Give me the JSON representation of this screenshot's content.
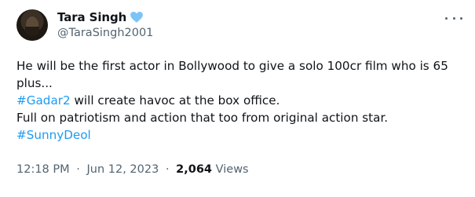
{
  "author": {
    "display_name": "Tara Singh",
    "handle": "@TaraSingh2001",
    "verified_color": "#7cc4f8"
  },
  "tweet": {
    "line1": "He will be the first actor in Bollywood to give a solo 100cr film who is 65",
    "line2": "plus...",
    "hashtag1": "#Gadar2",
    "line3_rest": " will create havoc at the box office.",
    "line4": "Full on patriotism and action that too from original action star.",
    "hashtag2": "#SunnyDeol"
  },
  "meta": {
    "time": "12:18 PM",
    "separator": "·",
    "date": "Jun 12, 2023",
    "views_count": "2,064",
    "views_label": "Views"
  },
  "colors": {
    "link": "#1d9bf0",
    "secondary_text": "#536471",
    "primary_text": "#0f1419"
  }
}
